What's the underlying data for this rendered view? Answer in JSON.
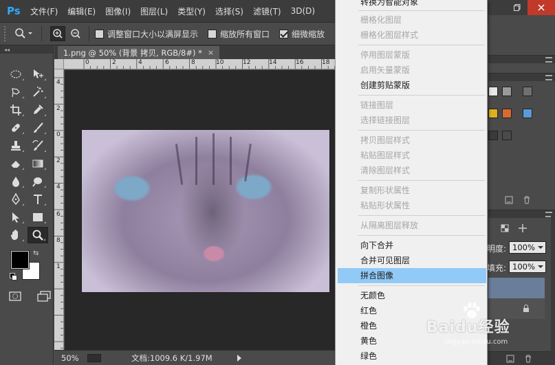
{
  "app": {
    "logo_text": "Ps",
    "menu": [
      "文件(F)",
      "编辑(E)",
      "图像(I)",
      "图层(L)",
      "类型(Y)",
      "选择(S)",
      "滤镜(T)",
      "3D(D)"
    ]
  },
  "options_bar": {
    "checkboxes": [
      {
        "label": "调整窗口大小以满屏显示",
        "checked": false
      },
      {
        "label": "缩放所有窗口",
        "checked": false
      },
      {
        "label": "细微缩放",
        "checked": true
      }
    ]
  },
  "toolbar": {
    "head_glyph": "◂◂"
  },
  "document": {
    "tab_title": "1.png @ 50% (背景 拷贝, RGB/8#) *",
    "tab_close": "×",
    "ruler_h_labels": [
      "0",
      "2",
      "4",
      "6",
      "8",
      "10",
      "12",
      "14",
      "16",
      "18"
    ],
    "ruler_v_labels": [
      "4",
      "2",
      "0",
      "2",
      "4",
      "6",
      "8",
      "1"
    ],
    "zoom": "50%",
    "doc_info": "文档:1009.6 K/1.97M"
  },
  "right_panels": {
    "opacity_label": "明度:",
    "opacity_value": "100%",
    "fill_label": "填充:",
    "fill_value": "100%"
  },
  "context_menu": {
    "items": [
      {
        "label": "转换为智能对象",
        "disabled": false
      },
      {
        "label": "栅格化图层",
        "disabled": true
      },
      {
        "label": "栅格化图层样式",
        "disabled": true
      },
      {
        "label": "停用图层蒙版",
        "disabled": true
      },
      {
        "label": "启用矢量蒙版",
        "disabled": true
      },
      {
        "label": "创建剪贴蒙版",
        "disabled": false
      },
      {
        "label": "链接图层",
        "disabled": true
      },
      {
        "label": "选择链接图层",
        "disabled": true
      },
      {
        "label": "拷贝图层样式",
        "disabled": true
      },
      {
        "label": "粘贴图层样式",
        "disabled": true
      },
      {
        "label": "清除图层样式",
        "disabled": true
      },
      {
        "label": "复制形状属性",
        "disabled": true
      },
      {
        "label": "粘贴形状属性",
        "disabled": true
      },
      {
        "label": "从隔离图层释放",
        "disabled": true
      },
      {
        "label": "向下合并",
        "disabled": false
      },
      {
        "label": "合并可见图层",
        "disabled": false
      },
      {
        "label": "拼合图像",
        "disabled": false,
        "highlighted": true
      },
      {
        "label": "无颜色",
        "disabled": false
      },
      {
        "label": "红色",
        "disabled": false
      },
      {
        "label": "橙色",
        "disabled": false
      },
      {
        "label": "黄色",
        "disabled": false
      },
      {
        "label": "绿色",
        "disabled": false
      }
    ]
  },
  "watermark": {
    "main": "Baidu经验",
    "sub": "jingyan.baidu.com"
  },
  "colors": {
    "accent_ps": "#31a8ff",
    "menu_hover": "#91c9f7",
    "panel_bg": "#4a4a4a",
    "canvas_bg": "#282828"
  }
}
